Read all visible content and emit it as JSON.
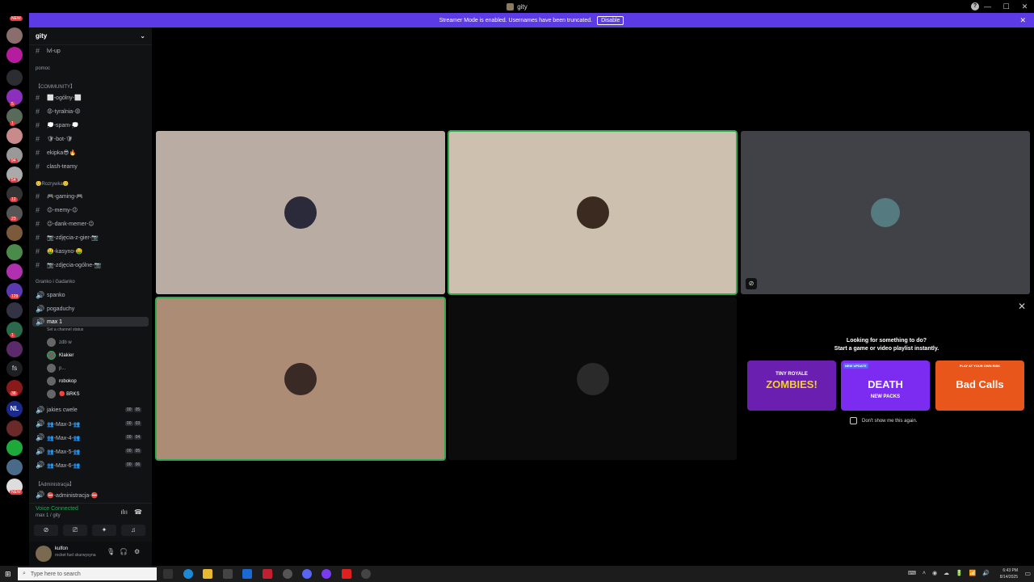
{
  "window": {
    "title": "gity",
    "min": "—",
    "max": "☐",
    "close": "✕"
  },
  "streamer": {
    "message": "Streamer Mode is enabled. Usernames have been truncated.",
    "disable_label": "Disable"
  },
  "server": {
    "name": "gity"
  },
  "channels": {
    "top": {
      "name": "lvl-up"
    },
    "pomoc": "pomoc",
    "community_cat": "【COMMUNITY】",
    "community": [
      "⬜-ogólny-⬜",
      "😡-tyralnia-😡",
      "💭-spam-💭",
      "🛡-bot-🛡",
      "ekipka😎🔥",
      "clash-teamy"
    ],
    "rozrywka_cat": "🙂Rozrywka🙂",
    "rozrywka": [
      "🎮-gaming-🎮",
      "😉-memy-😉",
      "😉-dank-memer-😉",
      "📷-zdjęcia-z-gier-📷",
      "🤑-kasyno-🤑",
      "📷-zdjęcia-ogólne-📷"
    ],
    "granko_cat": "Granko i Gadanko",
    "voice": [
      "spanko",
      "pogaduchy"
    ],
    "active_voice": {
      "name": "max 1",
      "status": "Set a channel status"
    },
    "members": [
      "zdb w",
      "Klakier",
      "p...",
      "robokop",
      "🔴 BRKS"
    ],
    "voice2": [
      {
        "name": "jakies cwele",
        "a": "00",
        "b": "05"
      },
      {
        "name": "👥-Max-3-👥",
        "a": "00",
        "b": "03"
      },
      {
        "name": "👥-Max-4-👥",
        "a": "00",
        "b": "04"
      },
      {
        "name": "👥-Max-5-👥",
        "a": "00",
        "b": "05"
      },
      {
        "name": "👥-Max-6-👥",
        "a": "00",
        "b": "06"
      }
    ],
    "admin_cat": "【Administracja】",
    "admin": [
      "⛔-administracja-⛔"
    ]
  },
  "voice_connected": {
    "title": "Voice Connected",
    "channel": "max 1 / gity"
  },
  "user": {
    "name": "kulfon",
    "status": "rocket fuel skurwysyna"
  },
  "activity": {
    "title": "Looking for something to do?",
    "subtitle": "Start a game or video playlist instantly.",
    "games": [
      {
        "tag": "",
        "name": "ZOMBIES!",
        "sub": "TINY ROYALE",
        "color": "#6a1fb0"
      },
      {
        "tag": "NEW UPDATE",
        "name": "DEATH",
        "sub": "NEW PACKS",
        "color": "#7b2cf0"
      },
      {
        "tag": "",
        "name": "Bad Calls",
        "sub": "PLAY AT YOUR OWN RISK",
        "color": "#e8561c"
      }
    ],
    "dont_show": "Don't show me this again."
  },
  "taskbar": {
    "search_placeholder": "Type here to search",
    "time": "6:43 PM",
    "date": "8/14/2025"
  },
  "guild_badges": [
    "NEW",
    "5",
    "1",
    "94",
    "54",
    "12",
    "23",
    "129",
    "1",
    "38",
    "NEW"
  ],
  "colors": {
    "accent": "#5c3be6",
    "speaking": "#2fa84f"
  }
}
